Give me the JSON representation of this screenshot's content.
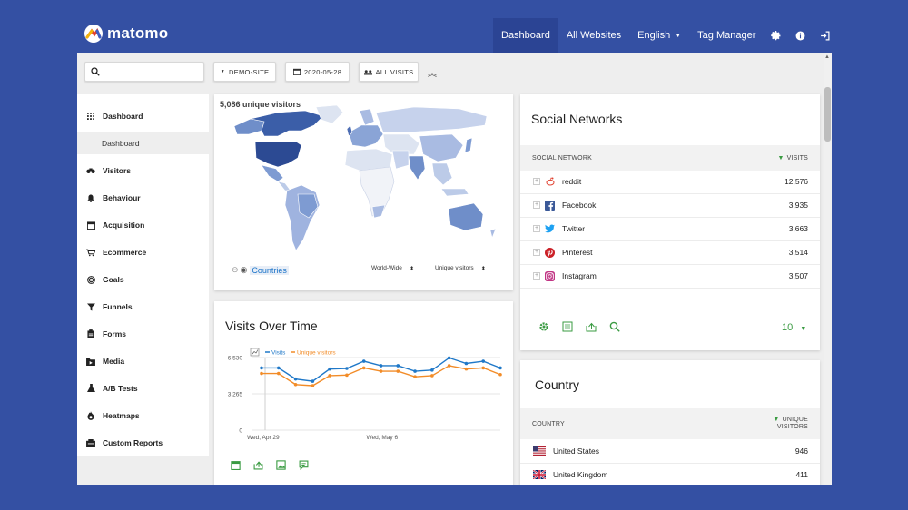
{
  "brand": {
    "name": "matomo"
  },
  "nav": {
    "dashboard": "Dashboard",
    "all_websites": "All Websites",
    "language": "English",
    "tag_manager": "Tag Manager"
  },
  "toolbar": {
    "search_value": "",
    "site": "DEMO-SITE",
    "date": "2020-05-28",
    "segment": "ALL VISITS"
  },
  "sidebar": {
    "items": [
      {
        "label": "Dashboard",
        "icon": "grid-icon"
      },
      {
        "label": "Visitors",
        "icon": "binoculars-icon"
      },
      {
        "label": "Behaviour",
        "icon": "bell-icon"
      },
      {
        "label": "Acquisition",
        "icon": "calendar-icon"
      },
      {
        "label": "Ecommerce",
        "icon": "cart-icon"
      },
      {
        "label": "Goals",
        "icon": "target-icon"
      },
      {
        "label": "Funnels",
        "icon": "funnel-icon"
      },
      {
        "label": "Forms",
        "icon": "clipboard-icon"
      },
      {
        "label": "Media",
        "icon": "media-icon"
      },
      {
        "label": "A/B Tests",
        "icon": "flask-icon"
      },
      {
        "label": "Heatmaps",
        "icon": "flame-icon"
      },
      {
        "label": "Custom Reports",
        "icon": "reports-icon"
      }
    ],
    "sub_item": "Dashboard"
  },
  "map_widget": {
    "title": "5,086 unique visitors",
    "link": "Countries",
    "region_select": "World-Wide",
    "metric_select": "Unique visitors"
  },
  "visits_over_time": {
    "title": "Visits Over Time",
    "legend_visits": "Visits",
    "legend_unique": "Unique visitors",
    "colors": {
      "visits": "#1f78c8",
      "unique": "#f28c28"
    }
  },
  "chart_data": {
    "type": "line",
    "y_ticks": [
      "6,530",
      "3,265",
      "0"
    ],
    "x_ticks": [
      "Wed, Apr 29",
      "Wed, May 6"
    ],
    "ylim": [
      0,
      6530
    ],
    "series": [
      {
        "name": "Visits",
        "values": [
          5600,
          5600,
          4600,
          4400,
          5500,
          5550,
          6200,
          5800,
          5800,
          5300,
          5400,
          6500,
          6000,
          6200,
          5600
        ]
      },
      {
        "name": "Unique visitors",
        "values": [
          5100,
          5100,
          4100,
          4000,
          4900,
          4950,
          5600,
          5300,
          5300,
          4800,
          4900,
          5800,
          5500,
          5600,
          5000
        ]
      }
    ]
  },
  "social_networks": {
    "title": "Social Networks",
    "col_label": "SOCIAL NETWORK",
    "col_visits": "VISITS",
    "rows": [
      {
        "label": "reddit",
        "value": "12,576",
        "icon": "reddit-icon"
      },
      {
        "label": "Facebook",
        "value": "3,935",
        "icon": "facebook-icon"
      },
      {
        "label": "Twitter",
        "value": "3,663",
        "icon": "twitter-icon"
      },
      {
        "label": "Pinterest",
        "value": "3,514",
        "icon": "pinterest-icon"
      },
      {
        "label": "Instagram",
        "value": "3,507",
        "icon": "instagram-icon"
      }
    ],
    "limit": "10"
  },
  "country": {
    "title": "Country",
    "col_label": "COUNTRY",
    "col_metric_1": "UNIQUE",
    "col_metric_2": "VISITORS",
    "rows": [
      {
        "label": "United States",
        "value": "946"
      },
      {
        "label": "United Kingdom",
        "value": "411"
      }
    ]
  }
}
